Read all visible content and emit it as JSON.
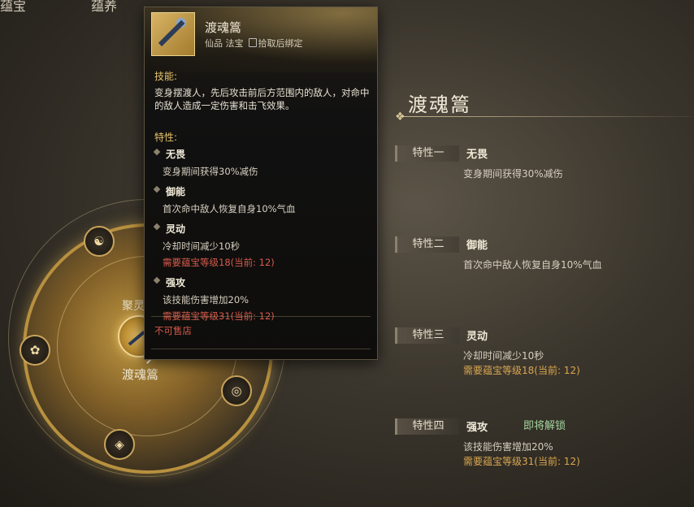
{
  "top_tabs": [
    "蕴宝",
    "蕴养"
  ],
  "wheel": {
    "juling_label": "聚灵",
    "center_label": "渡魂篙",
    "nodes": [
      "dragon-icon",
      "lotus-icon",
      "swirl-icon",
      "diamond-icon"
    ]
  },
  "tooltip": {
    "name": "渡魂篙",
    "meta_grade": "仙品 法宝",
    "meta_bind": "拾取后绑定",
    "skill_heading": "技能:",
    "skill_text": "变身摆渡人，先后攻击前后方范围内的敌人，对命中的敌人造成一定伤害和击飞效果。",
    "traits_heading": "特性:",
    "traits": [
      {
        "name": "无畏",
        "desc": "变身期间获得30%减伤",
        "req": ""
      },
      {
        "name": "御能",
        "desc": "首次命中敌人恢复自身10%气血",
        "req": ""
      },
      {
        "name": "灵动",
        "desc": "冷却时间减少10秒",
        "req": "需要蕴宝等级18(当前: 12)"
      },
      {
        "name": "强攻",
        "desc": "该技能伤害增加20%",
        "req": "需要蕴宝等级31(当前: 12)"
      }
    ],
    "not_sellable": "不可售店"
  },
  "detail": {
    "title": "渡魂篙",
    "traits": [
      {
        "tag": "特性一",
        "name": "无畏",
        "desc": "变身期间获得30%减伤",
        "req": "",
        "status": ""
      },
      {
        "tag": "特性二",
        "name": "御能",
        "desc": "首次命中敌人恢复自身10%气血",
        "req": "",
        "status": ""
      },
      {
        "tag": "特性三",
        "name": "灵动",
        "desc": "冷却时间减少10秒",
        "req": "需要蕴宝等级18(当前: 12)",
        "status": ""
      },
      {
        "tag": "特性四",
        "name": "强攻",
        "desc": "该技能伤害增加20%",
        "req": "需要蕴宝等级31(当前: 12)",
        "status": "即将解锁"
      }
    ]
  }
}
